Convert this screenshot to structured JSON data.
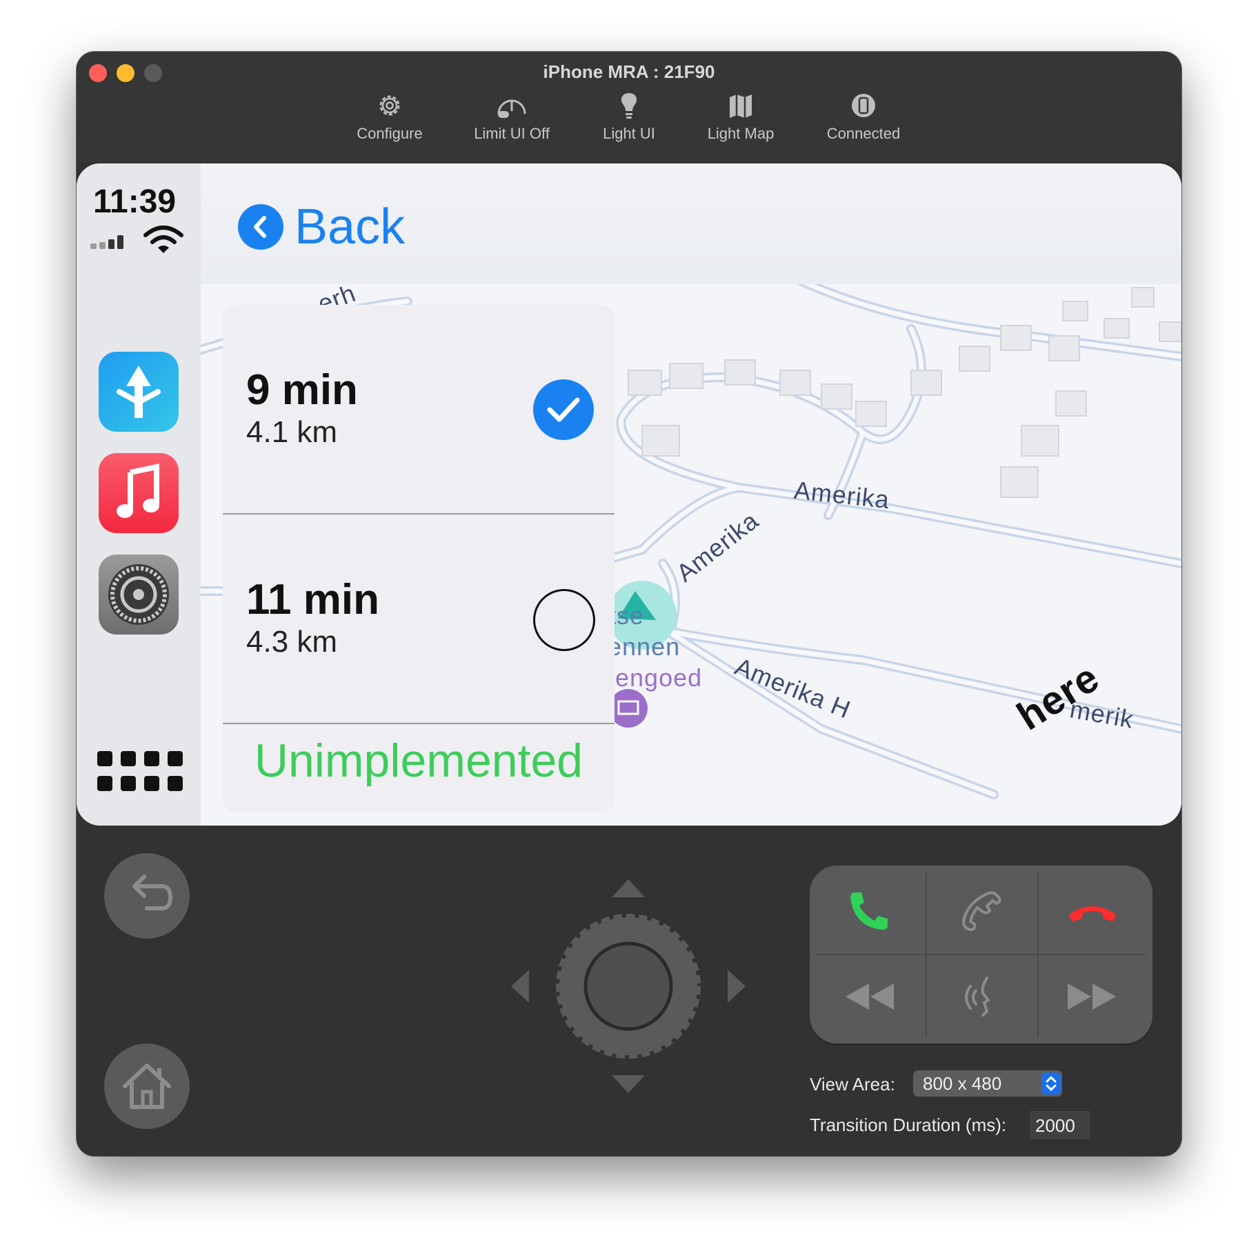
{
  "window": {
    "title": "iPhone MRA : 21F90"
  },
  "toolbar": {
    "configure": "Configure",
    "limit_ui": "Limit UI Off",
    "light_ui": "Light UI",
    "light_map": "Light Map",
    "connected": "Connected"
  },
  "carplay": {
    "time": "11:39",
    "back_label": "Back",
    "routes": [
      {
        "duration": "9 min",
        "distance": "4.1 km",
        "selected": true
      },
      {
        "duration": "11 min",
        "distance": "4.3 km",
        "selected": false
      }
    ],
    "unimplemented_label": "Unimplemented",
    "map_labels": {
      "street_1": "Amerika",
      "street_2": "Amerika",
      "street_3": "Amerika H",
      "street_4": "merik",
      "place_1": "tse",
      "place_2": "ennen",
      "place_3": "tengoed",
      "top_fragment": "erh",
      "brand": "here"
    }
  },
  "controls": {
    "view_area_label": "View Area:",
    "view_area_value": "800 x 480",
    "transition_label": "Transition Duration (ms):",
    "transition_value": "2000"
  },
  "colors": {
    "accent_blue": "#1a82f0",
    "green": "#3fcc5a",
    "call_green": "#2fd158",
    "hangup_red": "#ff2d2d"
  }
}
